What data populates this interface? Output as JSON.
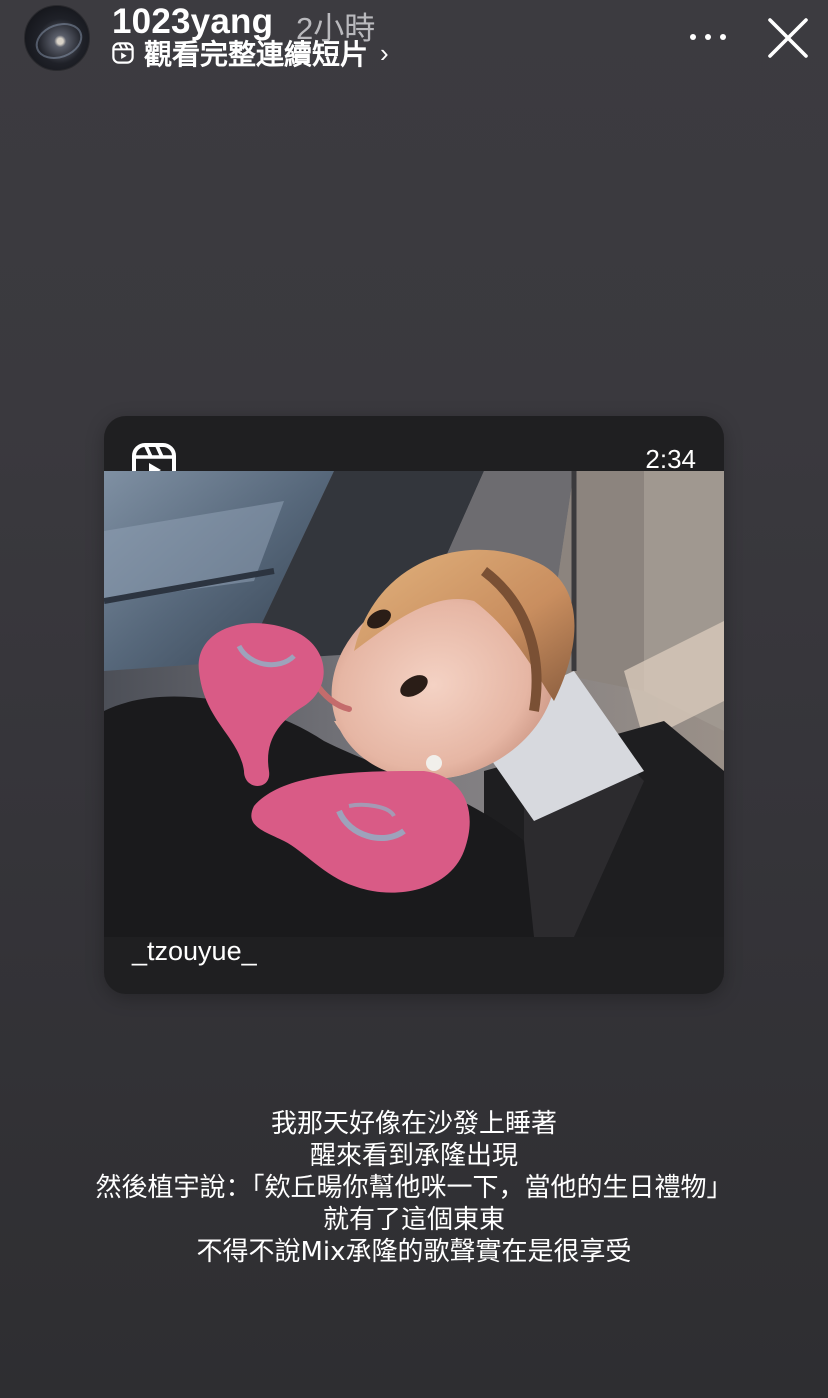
{
  "header": {
    "username": "1023yang",
    "timestamp": "2小時",
    "link_label": "觀看完整連續短片",
    "link_chevron": "›",
    "avatar_icon": "profile-photo",
    "more_icon": "more-horizontal-icon",
    "close_icon": "close-icon"
  },
  "card": {
    "duration": "2:34",
    "author": "_tzouyue_",
    "reels_icon": "reels-icon"
  },
  "caption": {
    "lines": [
      "我那天好像在沙發上睡著",
      "醒來看到承隆出現",
      "然後植宇說：「欸丘暘你幫他咪一下，當他的生日禮物」",
      "就有了這個東東",
      "不得不說Mix承隆的歌聲實在是很享受"
    ]
  },
  "colors": {
    "background_top": "#3c3b40",
    "background_bottom": "#2e2e31",
    "card_background": "#1f1f21",
    "pillow_pink": "#d95b86",
    "hair": "#c99264"
  }
}
